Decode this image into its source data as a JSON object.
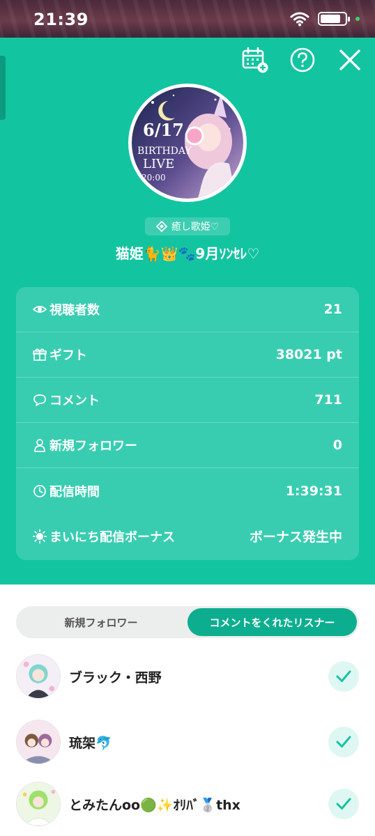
{
  "status_bar": {
    "time": "21:39"
  },
  "header": {
    "icons": [
      "calendar-add-icon",
      "help-icon",
      "close-icon"
    ]
  },
  "profile": {
    "thumbnail_date": "6/17",
    "thumbnail_title_line1": "BIRTHDAY",
    "thumbnail_title_line2": "LIVE",
    "thumbnail_time": "20:00",
    "genre_tag": "癒し歌姫♡",
    "name": "猫姫🐈👑🐾9月ｿﾝｾﾚ♡"
  },
  "stats": [
    {
      "icon": "eye-icon",
      "label": "視聴者数",
      "value": "21"
    },
    {
      "icon": "gift-icon",
      "label": "ギフト",
      "value": "38021 pt"
    },
    {
      "icon": "comment-icon",
      "label": "コメント",
      "value": "711"
    },
    {
      "icon": "person-icon",
      "label": "新規フォロワー",
      "value": "0"
    },
    {
      "icon": "clock-icon",
      "label": "配信時間",
      "value": "1:39:31"
    },
    {
      "icon": "sun-icon",
      "label": "まいにち配信ボーナス",
      "value": "ボーナス発生中"
    }
  ],
  "tabs": {
    "left": "新規フォロワー",
    "right": "コメントをくれたリスナー",
    "active": "right"
  },
  "listeners": [
    {
      "name": "ブラック・西野"
    },
    {
      "name": "琉架🐬"
    },
    {
      "name": "とみたんoo🟢✨ｵﾘﾊﾞ🥈thx"
    }
  ],
  "colors": {
    "primary": "#13c4a1",
    "accent": "#0cae8f",
    "check_bg": "#dff7f2"
  }
}
